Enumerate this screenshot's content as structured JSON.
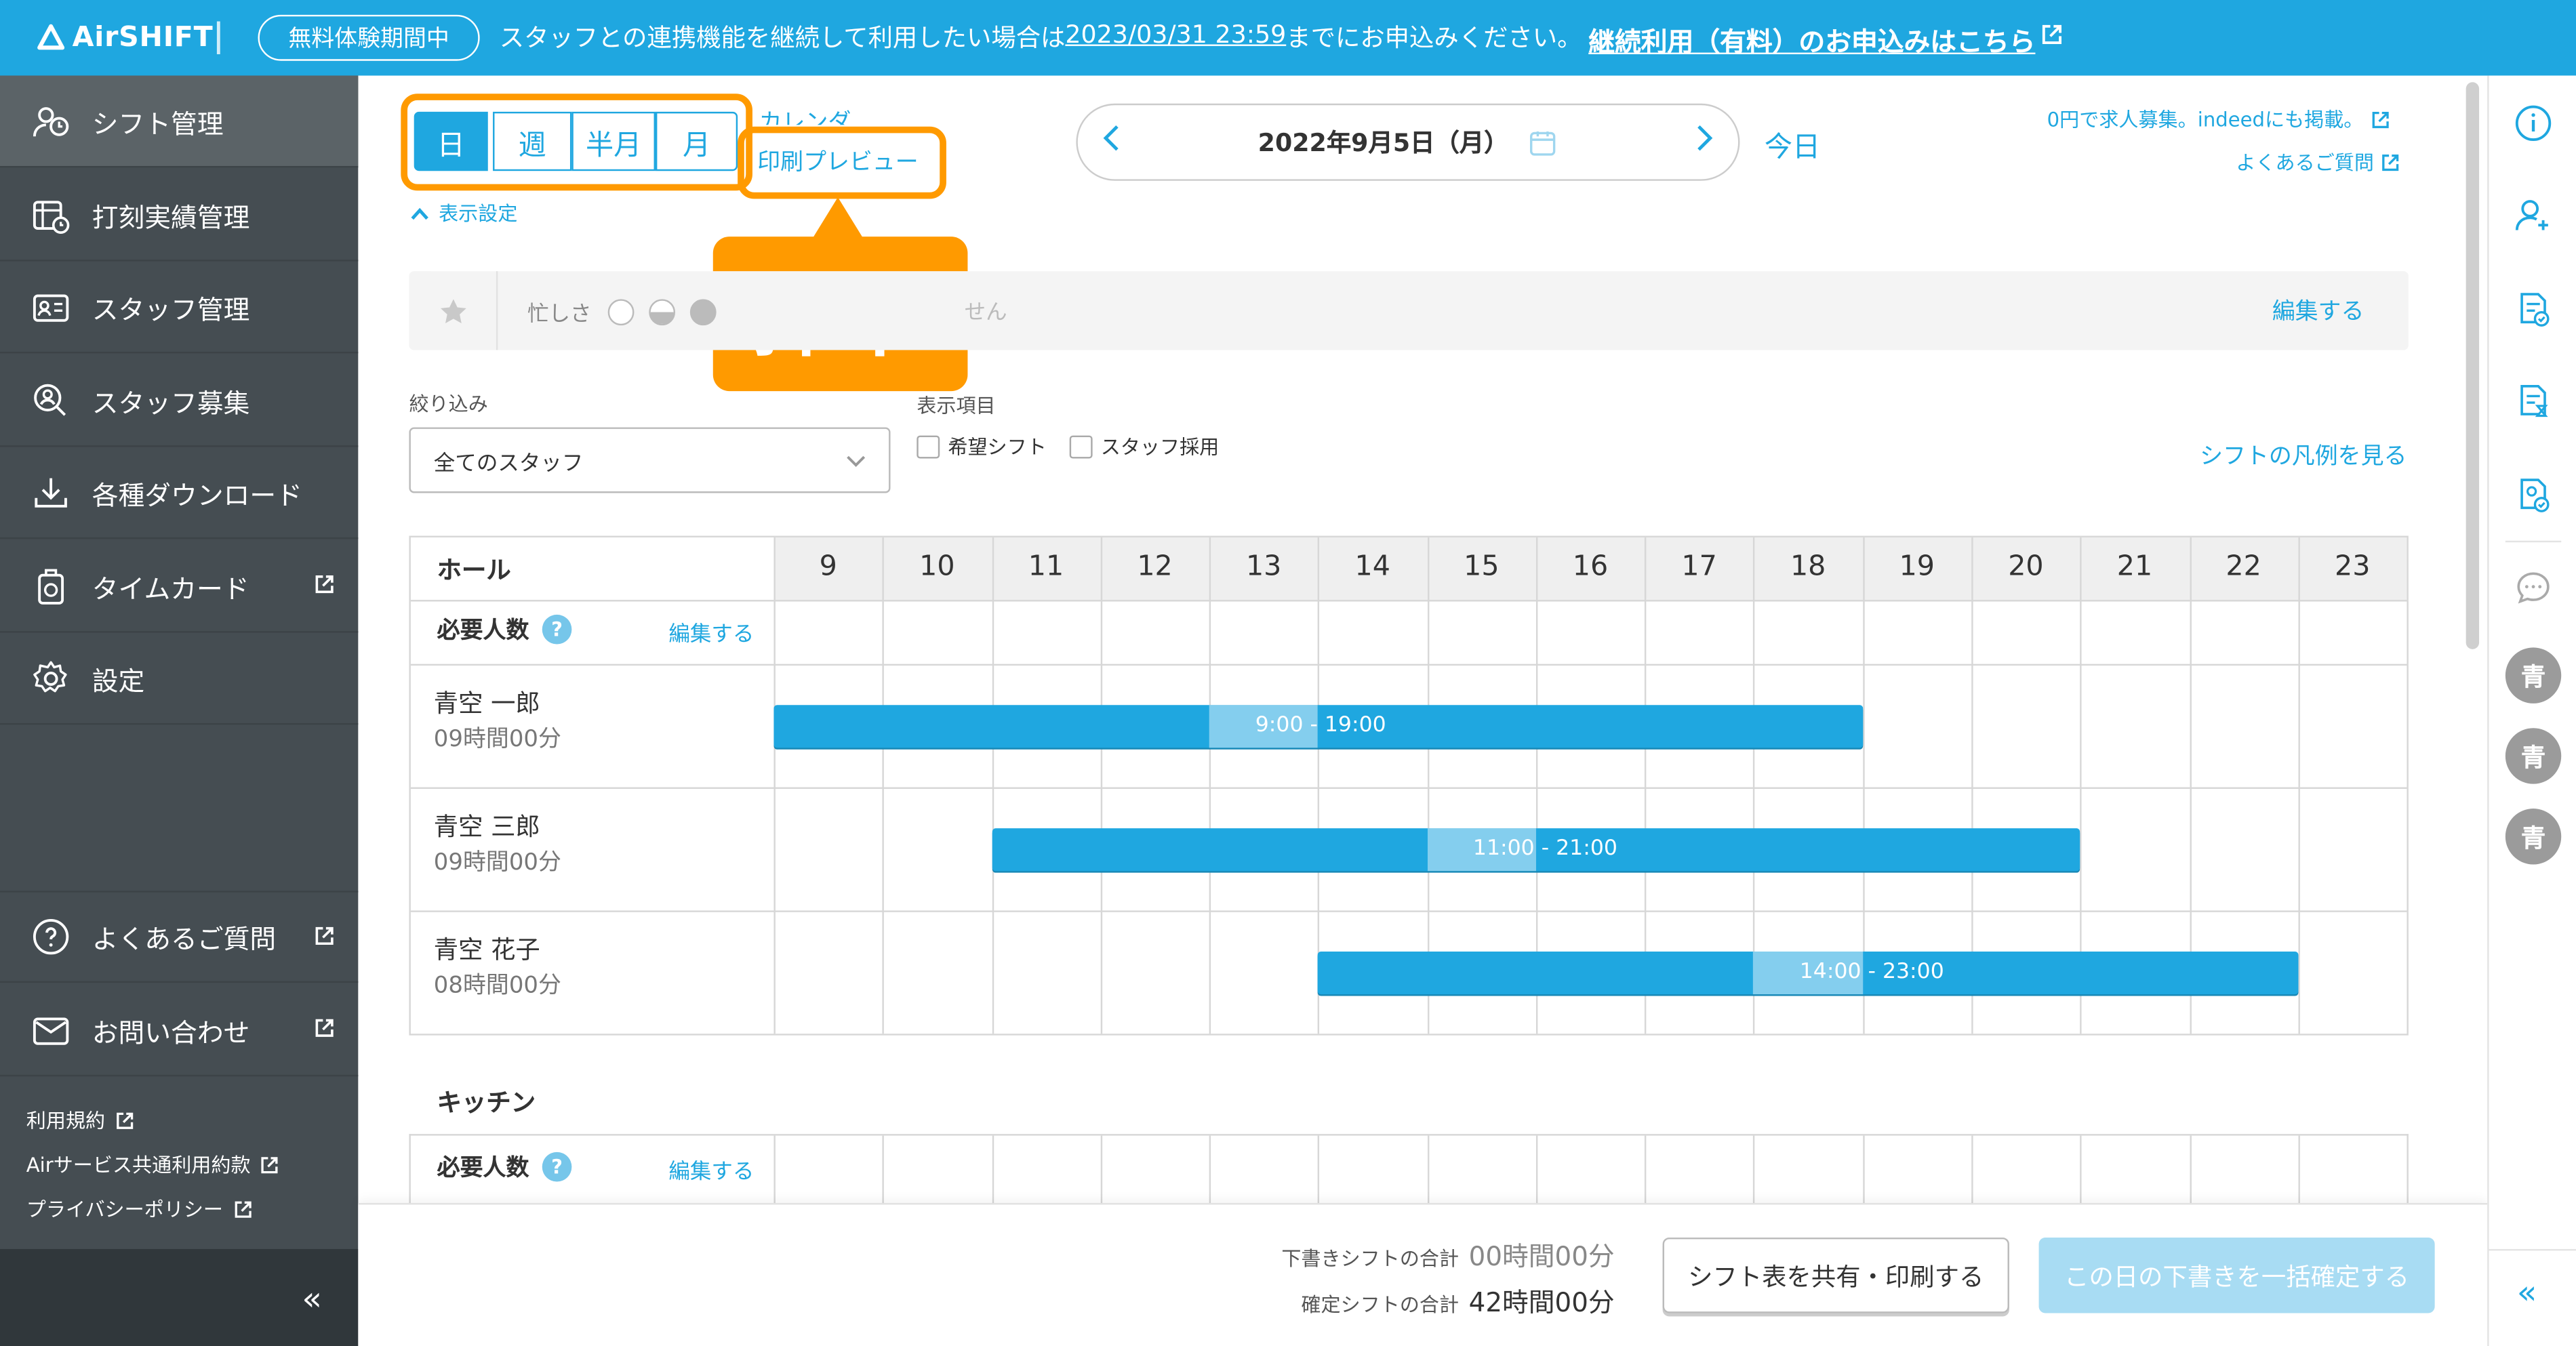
{
  "banner": {
    "logo": "AirSHIFT",
    "trial_badge": "無料体験期間中",
    "message_pre": "スタッフとの連携機能を継続して利用したい場合は",
    "message_date": "2023/03/31 23:59",
    "message_post": "までにお申込みください。",
    "link": "継続利用（有料）のお申込みはこちら"
  },
  "sidebar": {
    "items": [
      {
        "label": "シフト管理",
        "icon": "shift-icon"
      },
      {
        "label": "打刻実績管理",
        "icon": "clock-record-icon"
      },
      {
        "label": "スタッフ管理",
        "icon": "staff-card-icon"
      },
      {
        "label": "スタッフ募集",
        "icon": "recruit-icon"
      },
      {
        "label": "各種ダウンロード",
        "icon": "download-icon"
      },
      {
        "label": "タイムカード",
        "icon": "timecard-icon"
      },
      {
        "label": "設定",
        "icon": "gear-icon"
      }
    ],
    "help": "よくあるご質問",
    "contact": "お問い合わせ",
    "terms": "利用規約",
    "air_terms": "Airサービス共通利用約款",
    "privacy": "プライバシーポリシー",
    "collapse": "«"
  },
  "toolbar": {
    "views": [
      "日",
      "週",
      "半月",
      "月"
    ],
    "calendar_partial": "カレンダ",
    "print_preview": "印刷プレビュー",
    "display_settings": "表示設定",
    "callout": "押下",
    "date": "2022年9月5日（月）",
    "today": "今日",
    "indeed_link": "0円で求人募集。indeedにも掲載。",
    "faq_link": "よくあるご質問"
  },
  "busy": {
    "label": "忙しさ",
    "partial_text": "せん",
    "edit": "編集する"
  },
  "filter": {
    "label": "絞り込み",
    "value": "全てのスタッフ",
    "display_items_label": "表示項目",
    "opt_wish": "希望シフト",
    "opt_hire": "スタッフ採用",
    "legend_link": "シフトの凡例を見る"
  },
  "hall": {
    "section": "ホール",
    "hours": [
      "9",
      "10",
      "11",
      "12",
      "13",
      "14",
      "15",
      "16",
      "17",
      "18",
      "19",
      "20",
      "21",
      "22",
      "23"
    ],
    "required": "必要人数",
    "required_edit": "編集する",
    "staff": [
      {
        "name": "青空 一郎",
        "total": "09時間00分",
        "shift": "9:00 - 19:00",
        "start": 9,
        "end": 19
      },
      {
        "name": "青空 三郎",
        "total": "09時間00分",
        "shift": "11:00 - 21:00",
        "start": 11,
        "end": 21
      },
      {
        "name": "青空 花子",
        "total": "08時間00分",
        "shift": "14:00 - 23:00",
        "start": 14,
        "end": 23
      }
    ]
  },
  "kitchen": {
    "section": "キッチン",
    "required": "必要人数",
    "required_edit": "編集する"
  },
  "right_rail": {
    "avatars": [
      "青",
      "青",
      "青"
    ]
  },
  "footer": {
    "draft_label": "下書きシフトの合計",
    "draft_value": "00時間00分",
    "confirmed_label": "確定シフトの合計",
    "confirmed_value": "42時間00分",
    "share_button": "シフト表を共有・印刷する",
    "confirm_button": "この日の下書きを一括確定する"
  },
  "colors": {
    "accent": "#1fa7e0",
    "highlight": "#ff9a00",
    "sidebar": "#454d52"
  }
}
